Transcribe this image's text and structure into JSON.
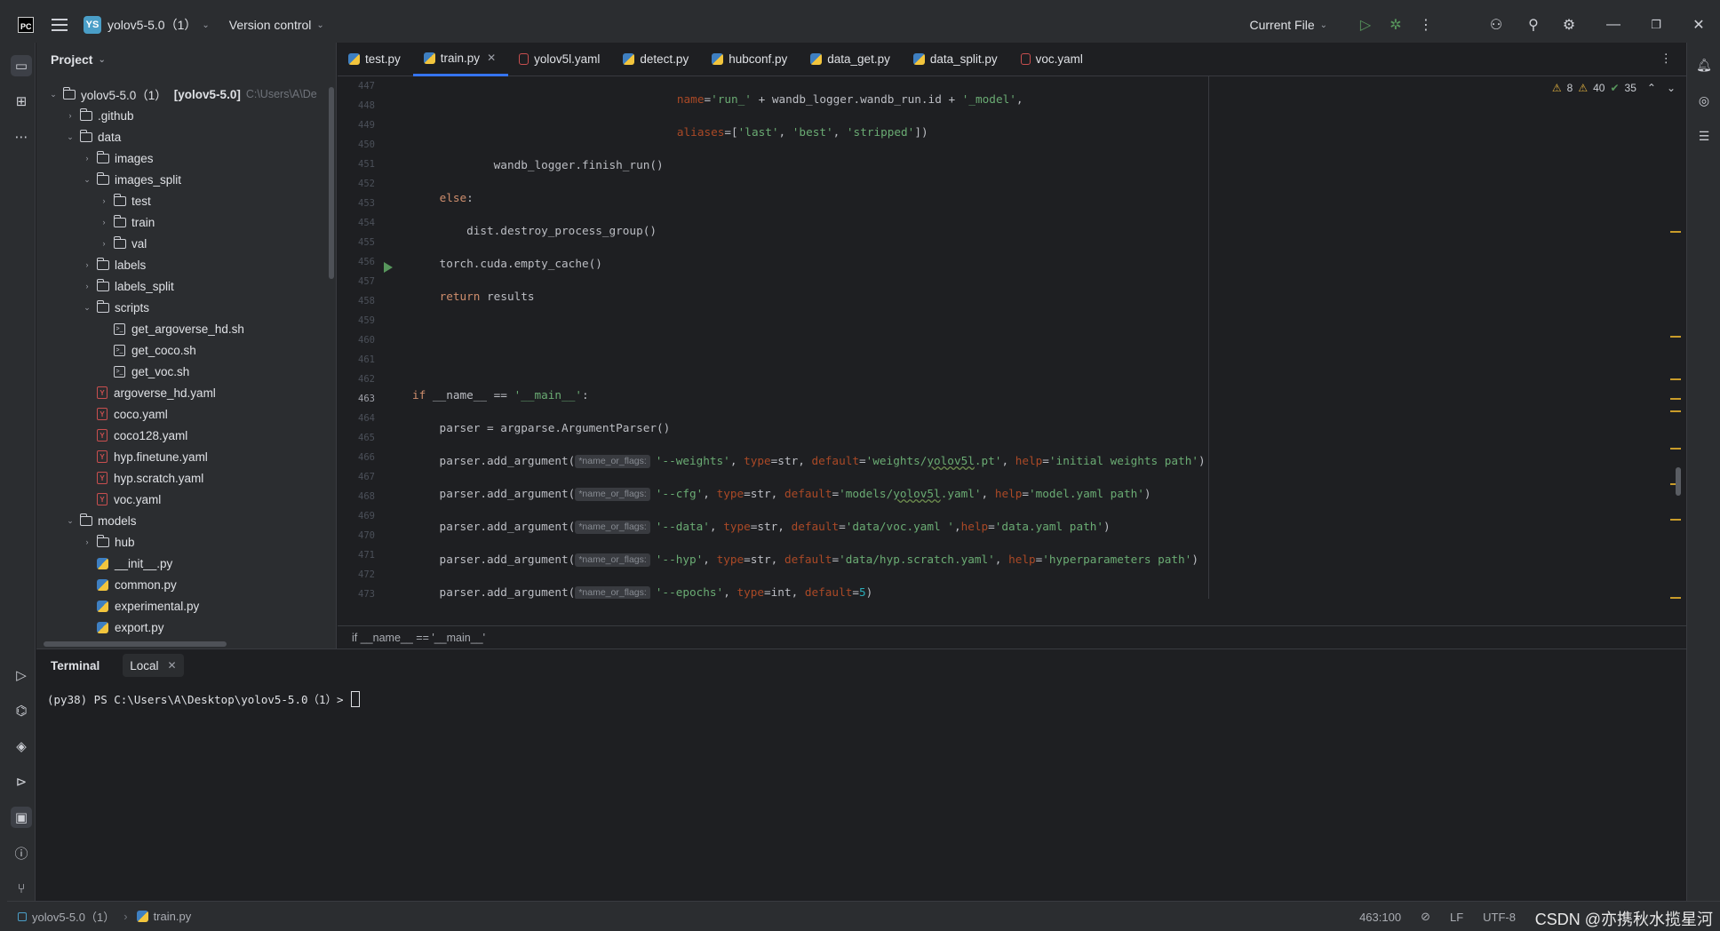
{
  "titlebar": {
    "logo": "PC",
    "project_badge": "YS",
    "project_name": "yolov5-5.0（1）",
    "vcs": "Version control",
    "run_config": "Current File"
  },
  "project_panel": {
    "title": "Project",
    "tree": [
      {
        "depth": 0,
        "type": "folder",
        "open": true,
        "name": "yolov5-5.0（1）",
        "bold": "[yolov5-5.0]",
        "path": "C:\\Users\\A\\De"
      },
      {
        "depth": 1,
        "type": "folder",
        "open": false,
        "name": ".github"
      },
      {
        "depth": 1,
        "type": "folder",
        "open": true,
        "name": "data"
      },
      {
        "depth": 2,
        "type": "folder",
        "open": false,
        "name": "images"
      },
      {
        "depth": 2,
        "type": "folder",
        "open": true,
        "name": "images_split"
      },
      {
        "depth": 3,
        "type": "folder",
        "open": false,
        "name": "test"
      },
      {
        "depth": 3,
        "type": "folder",
        "open": false,
        "name": "train"
      },
      {
        "depth": 3,
        "type": "folder",
        "open": false,
        "name": "val"
      },
      {
        "depth": 2,
        "type": "folder",
        "open": false,
        "name": "labels"
      },
      {
        "depth": 2,
        "type": "folder",
        "open": false,
        "name": "labels_split"
      },
      {
        "depth": 2,
        "type": "folder",
        "open": true,
        "name": "scripts"
      },
      {
        "depth": 3,
        "type": "sh",
        "name": "get_argoverse_hd.sh"
      },
      {
        "depth": 3,
        "type": "sh",
        "name": "get_coco.sh"
      },
      {
        "depth": 3,
        "type": "sh",
        "name": "get_voc.sh"
      },
      {
        "depth": 2,
        "type": "yaml",
        "name": "argoverse_hd.yaml"
      },
      {
        "depth": 2,
        "type": "yaml",
        "name": "coco.yaml"
      },
      {
        "depth": 2,
        "type": "yaml",
        "name": "coco128.yaml"
      },
      {
        "depth": 2,
        "type": "yaml",
        "name": "hyp.finetune.yaml"
      },
      {
        "depth": 2,
        "type": "yaml",
        "name": "hyp.scratch.yaml"
      },
      {
        "depth": 2,
        "type": "yaml",
        "name": "voc.yaml"
      },
      {
        "depth": 1,
        "type": "folder",
        "open": true,
        "name": "models"
      },
      {
        "depth": 2,
        "type": "folder",
        "open": false,
        "name": "hub"
      },
      {
        "depth": 2,
        "type": "py",
        "name": "__init__.py"
      },
      {
        "depth": 2,
        "type": "py",
        "name": "common.py"
      },
      {
        "depth": 2,
        "type": "py",
        "name": "experimental.py"
      },
      {
        "depth": 2,
        "type": "py",
        "name": "export.py"
      }
    ]
  },
  "editor": {
    "tabs": [
      {
        "label": "test.py",
        "type": "py"
      },
      {
        "label": "train.py",
        "type": "py",
        "active": true
      },
      {
        "label": "yolov5l.yaml",
        "type": "yaml"
      },
      {
        "label": "detect.py",
        "type": "py"
      },
      {
        "label": "hubconf.py",
        "type": "py"
      },
      {
        "label": "data_get.py",
        "type": "py"
      },
      {
        "label": "data_split.py",
        "type": "py"
      },
      {
        "label": "voc.yaml",
        "type": "yaml"
      }
    ],
    "inspections": {
      "warnings": "8",
      "weak_warnings": "40",
      "ok": "35"
    },
    "current_line": "463",
    "hint": "*name_or_flags:",
    "breadcrumb": "if __name__ == '__main__'"
  },
  "terminal": {
    "tab": "Terminal",
    "session": "Local",
    "prompt": "(py38) PS C:\\Users\\A\\Desktop\\yolov5-5.0（1）>"
  },
  "status": {
    "project": "yolov5-5.0（1）",
    "file": "train.py",
    "position": "463:100",
    "line_sep": "LF",
    "encoding": "UTF-8",
    "watermark": "CSDN @亦携秋水揽星河"
  }
}
